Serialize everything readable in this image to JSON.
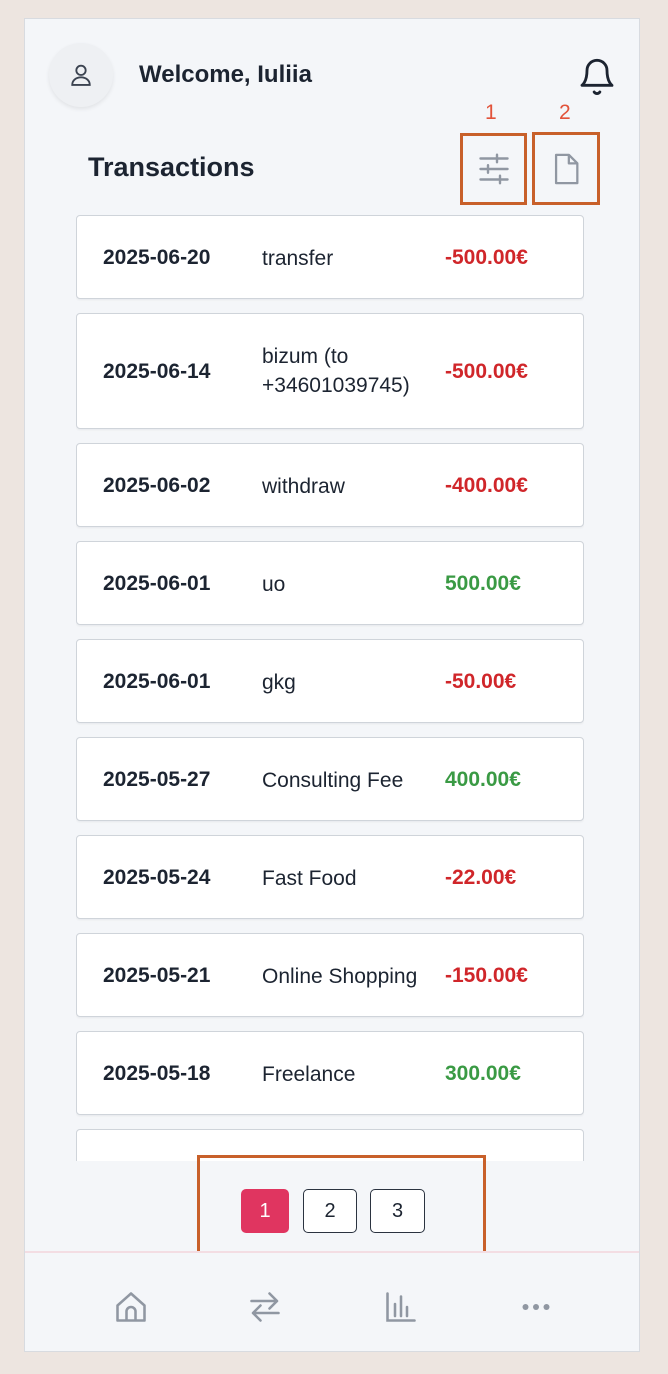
{
  "header": {
    "welcome": "Welcome, Iuliia"
  },
  "page_title": "Transactions",
  "annotations": {
    "label_1": "1",
    "label_2": "2"
  },
  "toolbar": {
    "filter_icon": "sliders-icon",
    "export_icon": "document-icon"
  },
  "transactions": [
    {
      "date": "2025-06-20",
      "description": "transfer",
      "amount": "-500.00€",
      "kind": "neg"
    },
    {
      "date": "2025-06-14",
      "description": "bizum (to +34601039745)",
      "amount": "-500.00€",
      "kind": "neg"
    },
    {
      "date": "2025-06-02",
      "description": "withdraw",
      "amount": "-400.00€",
      "kind": "neg"
    },
    {
      "date": "2025-06-01",
      "description": "uo",
      "amount": "500.00€",
      "kind": "pos"
    },
    {
      "date": "2025-06-01",
      "description": "gkg",
      "amount": "-50.00€",
      "kind": "neg"
    },
    {
      "date": "2025-05-27",
      "description": "Consulting Fee",
      "amount": "400.00€",
      "kind": "pos"
    },
    {
      "date": "2025-05-24",
      "description": "Fast Food",
      "amount": "-22.00€",
      "kind": "neg"
    },
    {
      "date": "2025-05-21",
      "description": "Online Shopping",
      "amount": "-150.00€",
      "kind": "neg"
    },
    {
      "date": "2025-05-18",
      "description": "Freelance",
      "amount": "300.00€",
      "kind": "pos"
    },
    {
      "date": "",
      "description": "",
      "amount": "",
      "kind": "neg"
    }
  ],
  "pagination": {
    "pages": [
      "1",
      "2",
      "3"
    ],
    "current": "1"
  },
  "bottom_nav": [
    "home-icon",
    "transfer-arrows-icon",
    "bar-chart-icon",
    "more-dots-icon"
  ],
  "colors": {
    "negative": "#d0262a",
    "positive": "#3a9a44",
    "accent": "#e03560",
    "annotation": "#c8602a"
  }
}
